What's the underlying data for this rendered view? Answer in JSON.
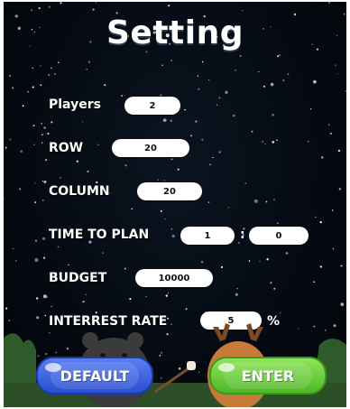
{
  "title": "Setting",
  "settings": {
    "players": {
      "label": "Players",
      "value": "2"
    },
    "row": {
      "label": "ROW",
      "value": "20"
    },
    "column": {
      "label": "COLUMN",
      "value": "20"
    },
    "time_to_plan": {
      "label": "TIME TO PLAN",
      "minutes": "1",
      "separator": ":",
      "seconds": "0"
    },
    "budget": {
      "label": "BUDGET",
      "value": "10000"
    },
    "interest_rate": {
      "label": "INTERREST RATE",
      "value": "5",
      "unit": "%"
    }
  },
  "buttons": {
    "default_label": "DEFAULT",
    "enter_label": "ENTER"
  },
  "colors": {
    "background": "#050a12",
    "default_button": "#2a4fd0",
    "enter_button": "#4fb828",
    "field": "#ffffff",
    "text": "#ffffff"
  },
  "icons": [
    "bear-character",
    "deer-character",
    "marshmallow-stick",
    "bush"
  ]
}
